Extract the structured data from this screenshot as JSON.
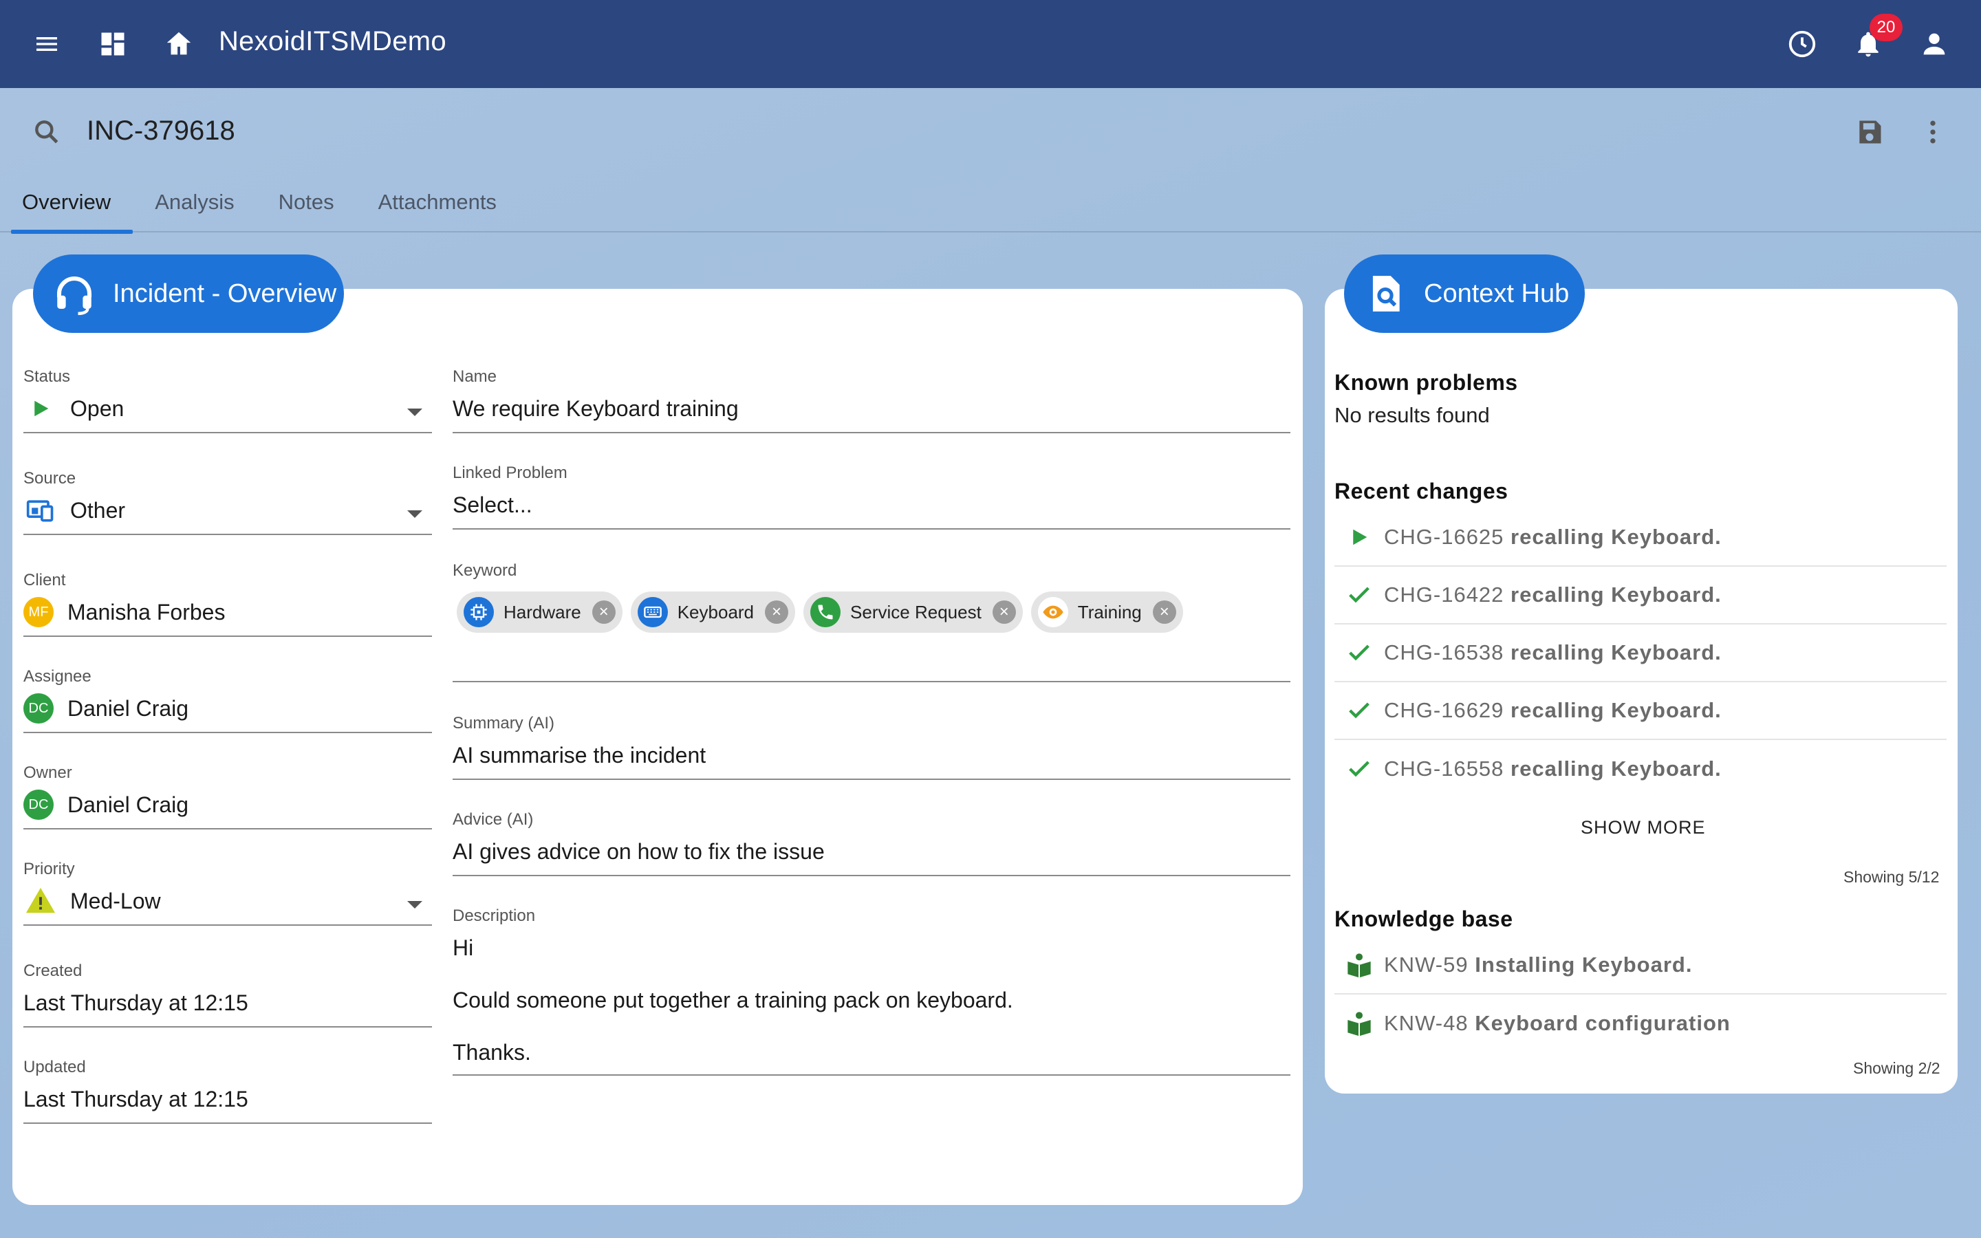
{
  "app": {
    "title": "NexoidITSMDemo",
    "notification_count": "20"
  },
  "record": {
    "id": "INC-379618"
  },
  "tabs": [
    {
      "label": "Overview"
    },
    {
      "label": "Analysis"
    },
    {
      "label": "Notes"
    },
    {
      "label": "Attachments"
    }
  ],
  "overview": {
    "title": "Incident - Overview",
    "status": {
      "label": "Status",
      "value": "Open"
    },
    "source": {
      "label": "Source",
      "value": "Other"
    },
    "client": {
      "label": "Client",
      "value": "Manisha Forbes",
      "initials": "MF"
    },
    "assignee": {
      "label": "Assignee",
      "value": "Daniel Craig",
      "initials": "DC"
    },
    "owner": {
      "label": "Owner",
      "value": "Daniel Craig",
      "initials": "DC"
    },
    "priority": {
      "label": "Priority",
      "value": "Med-Low"
    },
    "created": {
      "label": "Created",
      "value": "Last Thursday at 12:15"
    },
    "updated": {
      "label": "Updated",
      "value": "Last Thursday at 12:15"
    },
    "name": {
      "label": "Name",
      "value": "We require Keyboard training"
    },
    "linked_problem": {
      "label": "Linked Problem",
      "value": "Select..."
    },
    "keyword": {
      "label": "Keyword",
      "chips": [
        {
          "label": "Hardware",
          "icon": "chip-cpu-icon"
        },
        {
          "label": "Keyboard",
          "icon": "keyboard-icon"
        },
        {
          "label": "Service Request",
          "icon": "phone-icon"
        },
        {
          "label": "Training",
          "icon": "eye-icon"
        }
      ]
    },
    "summary": {
      "label": "Summary (AI)",
      "value": "AI summarise the incident"
    },
    "advice": {
      "label": "Advice (AI)",
      "value": "AI gives advice on how to fix the issue"
    },
    "description": {
      "label": "Description",
      "lines": [
        "Hi",
        "Could someone put together a training pack on keyboard.",
        "Thanks."
      ]
    }
  },
  "context_hub": {
    "title": "Context Hub",
    "known_problems": {
      "heading": "Known problems",
      "empty": "No results found"
    },
    "recent_changes": {
      "heading": "Recent changes",
      "items": [
        {
          "id": "CHG-16625",
          "text": "recalling Keyboard.",
          "state": "in-progress"
        },
        {
          "id": "CHG-16422",
          "text": "recalling Keyboard.",
          "state": "done"
        },
        {
          "id": "CHG-16538",
          "text": "recalling Keyboard.",
          "state": "done"
        },
        {
          "id": "CHG-16629",
          "text": "recalling Keyboard.",
          "state": "done"
        },
        {
          "id": "CHG-16558",
          "text": "recalling Keyboard.",
          "state": "done"
        }
      ],
      "show_more": "SHOW MORE",
      "showing": "Showing 5/12"
    },
    "knowledge_base": {
      "heading": "Knowledge base",
      "items": [
        {
          "id": "KNW-59",
          "text": "Installing Keyboard."
        },
        {
          "id": "KNW-48",
          "text": "Keyboard configuration"
        }
      ],
      "showing": "Showing 2/2"
    }
  },
  "colors": {
    "appbar": "#2c4680",
    "accent": "#1e73d8",
    "status_open": "#2ea043",
    "avatar_client": "#f5b800",
    "avatar_user": "#2ea043",
    "priority_warning": "#c6d21e",
    "badge": "#e8203a"
  }
}
